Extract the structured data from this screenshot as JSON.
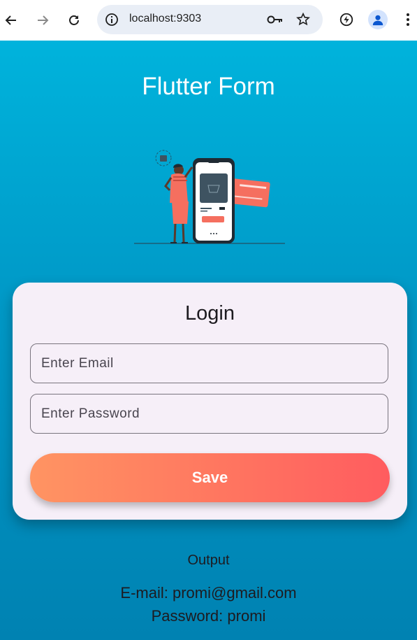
{
  "browser": {
    "url": "localhost:9303",
    "icons": [
      "back-icon",
      "forward-icon",
      "reload-icon",
      "site-info-icon",
      "password-key-icon",
      "bookmark-star-icon",
      "performance-icon",
      "profile-avatar-icon",
      "menu-kebab-icon"
    ]
  },
  "app": {
    "title": "Flutter Form"
  },
  "login": {
    "title": "Login",
    "email_placeholder": "Enter Email",
    "password_placeholder": "Enter Password",
    "save_label": "Save"
  },
  "output": {
    "label": "Output",
    "email_line": "E-mail: promi@gmail.com",
    "password_line": "Password: promi"
  },
  "colors": {
    "background_top": "#00b3dc",
    "background_bottom": "#0082b2",
    "card": "#f6eff8",
    "button_start": "#ff9462",
    "button_end": "#ff5c5f"
  }
}
